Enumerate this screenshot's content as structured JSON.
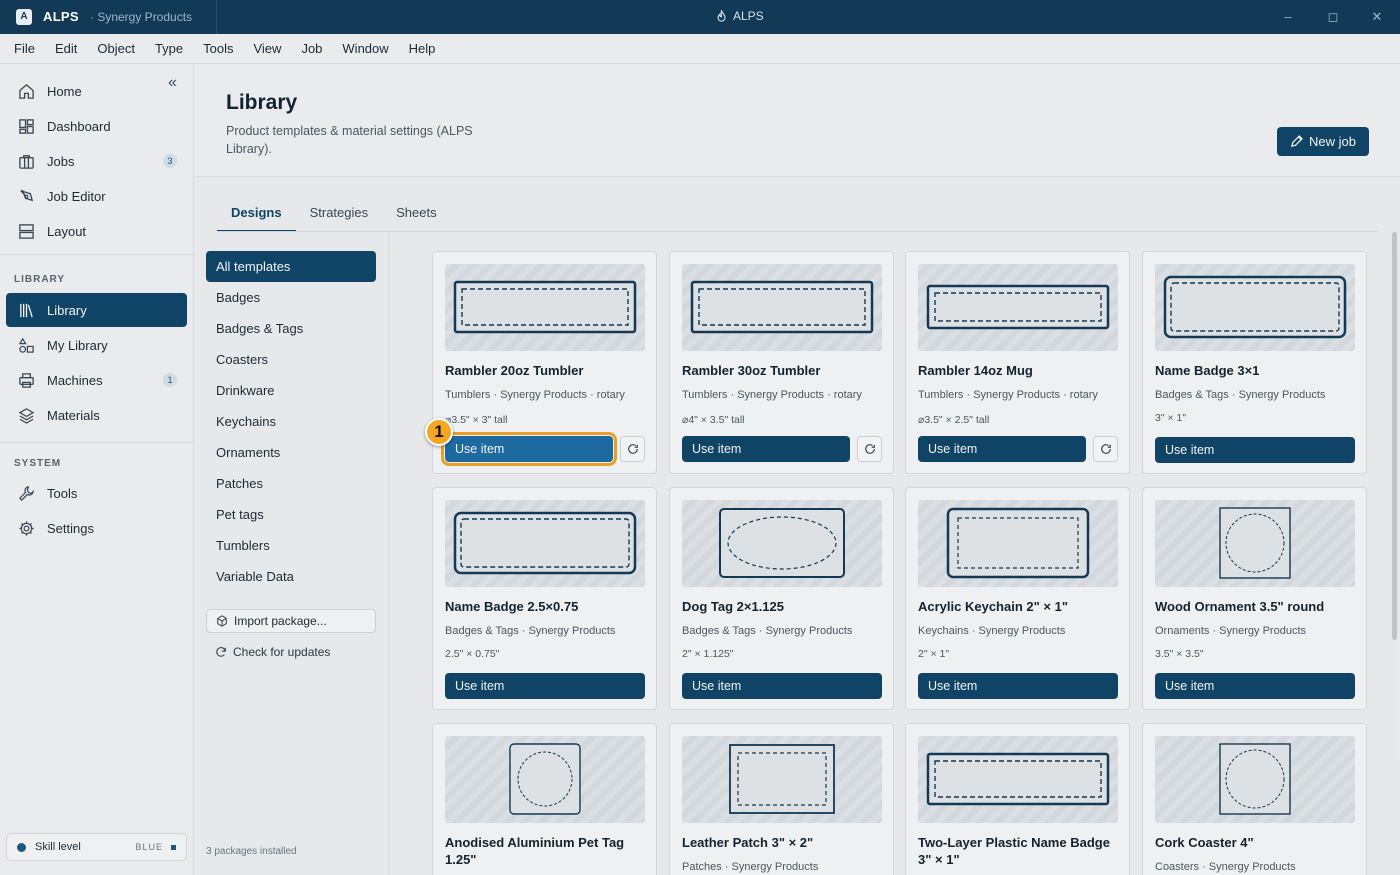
{
  "titlebar": {
    "logo_letter": "A",
    "app_name": "ALPS",
    "workspace": "· Synergy Products",
    "center_title": "ALPS"
  },
  "menu": [
    "File",
    "Edit",
    "Object",
    "Type",
    "Tools",
    "View",
    "Job",
    "Window",
    "Help"
  ],
  "sidebar": {
    "nav": [
      {
        "label": "Home",
        "icon": "home-icon"
      },
      {
        "label": "Dashboard",
        "icon": "dashboard-icon"
      },
      {
        "label": "Jobs",
        "icon": "briefcase-icon",
        "badge": "3"
      },
      {
        "label": "Job Editor",
        "icon": "pen-tool-icon"
      },
      {
        "label": "Layout",
        "icon": "layout-icon"
      }
    ],
    "library_label": "LIBRARY",
    "library_nav": [
      {
        "label": "Library",
        "icon": "library-icon",
        "active": true
      },
      {
        "label": "My Library",
        "icon": "shapes-icon"
      },
      {
        "label": "Machines",
        "icon": "printer-icon",
        "badge": "1"
      },
      {
        "label": "Materials",
        "icon": "layers-icon"
      }
    ],
    "system_label": "SYSTEM",
    "system_nav": [
      {
        "label": "Tools",
        "icon": "wrench-icon"
      },
      {
        "label": "Settings",
        "icon": "gear-icon"
      }
    ],
    "skill": {
      "label": "Skill level",
      "value": "BLUE"
    }
  },
  "header": {
    "title": "Library",
    "description": "Product templates & material settings (ALPS Library).",
    "new_job": "New job"
  },
  "tabs": [
    "Designs",
    "Strategies",
    "Sheets"
  ],
  "categories": [
    "All templates",
    "Badges",
    "Badges & Tags",
    "Coasters",
    "Drinkware",
    "Keychains",
    "Ornaments",
    "Patches",
    "Pet tags",
    "Tumblers",
    "Variable Data"
  ],
  "import_label": "Import package...",
  "check_label": "Check for updates",
  "packages_note": "3 packages installed",
  "marker": "1",
  "cards": [
    {
      "title": "Rambler 20oz Tumbler",
      "meta": "Tumblers · Synergy Products · rotary",
      "dims": "⌀3.5\" × 3\" tall",
      "button": "Use item",
      "refresh": true,
      "shape": "rect-wide"
    },
    {
      "title": "Rambler 30oz Tumbler",
      "meta": "Tumblers · Synergy Products · rotary",
      "dims": "⌀4\" × 3.5\" tall",
      "button": "Use item",
      "refresh": true,
      "shape": "rect-wide"
    },
    {
      "title": "Rambler 14oz Mug",
      "meta": "Tumblers · Synergy Products · rotary",
      "dims": "⌀3.5\" × 2.5\" tall",
      "button": "Use item",
      "refresh": true,
      "shape": "rect-thin"
    },
    {
      "title": "Name Badge 3×1",
      "meta": "Badges & Tags · Synergy Products",
      "dims": "3\" × 1\"",
      "button": "Use item",
      "refresh": false,
      "shape": "rect-round"
    },
    {
      "title": "Name Badge 2.5×0.75",
      "meta": "Badges & Tags · Synergy Products",
      "dims": "2.5\" × 0.75\"",
      "button": "Use item",
      "refresh": false,
      "shape": "rect-round"
    },
    {
      "title": "Dog Tag 2×1.125",
      "meta": "Badges & Tags · Synergy Products",
      "dims": "2\" × 1.125\"",
      "button": "Use item",
      "refresh": false,
      "shape": "ellipse"
    },
    {
      "title": "Acrylic Keychain 2\" × 1\"",
      "meta": "Keychains · Synergy Products",
      "dims": "2\" × 1\"",
      "button": "Use item",
      "refresh": false,
      "shape": "rect-key"
    },
    {
      "title": "Wood Ornament 3.5\" round",
      "meta": "Ornaments · Synergy Products",
      "dims": "3.5\" × 3.5\"",
      "button": "Use item",
      "refresh": false,
      "shape": "circle"
    },
    {
      "title": "Anodised Aluminium Pet Tag 1.25\"",
      "meta": "",
      "dims": "",
      "button": "",
      "refresh": false,
      "shape": "circle-round"
    },
    {
      "title": "Leather Patch 3\" × 2\"",
      "meta": "Patches · Synergy Products",
      "dims": "",
      "button": "",
      "refresh": false,
      "shape": "rect-patch"
    },
    {
      "title": "Two-Layer Plastic Name Badge 3\" × 1\"",
      "meta": "",
      "dims": "",
      "button": "",
      "refresh": false,
      "shape": "rect-wide"
    },
    {
      "title": "Cork Coaster 4\"",
      "meta": "Coasters · Synergy Products",
      "dims": "",
      "button": "",
      "refresh": false,
      "shape": "circle"
    }
  ]
}
